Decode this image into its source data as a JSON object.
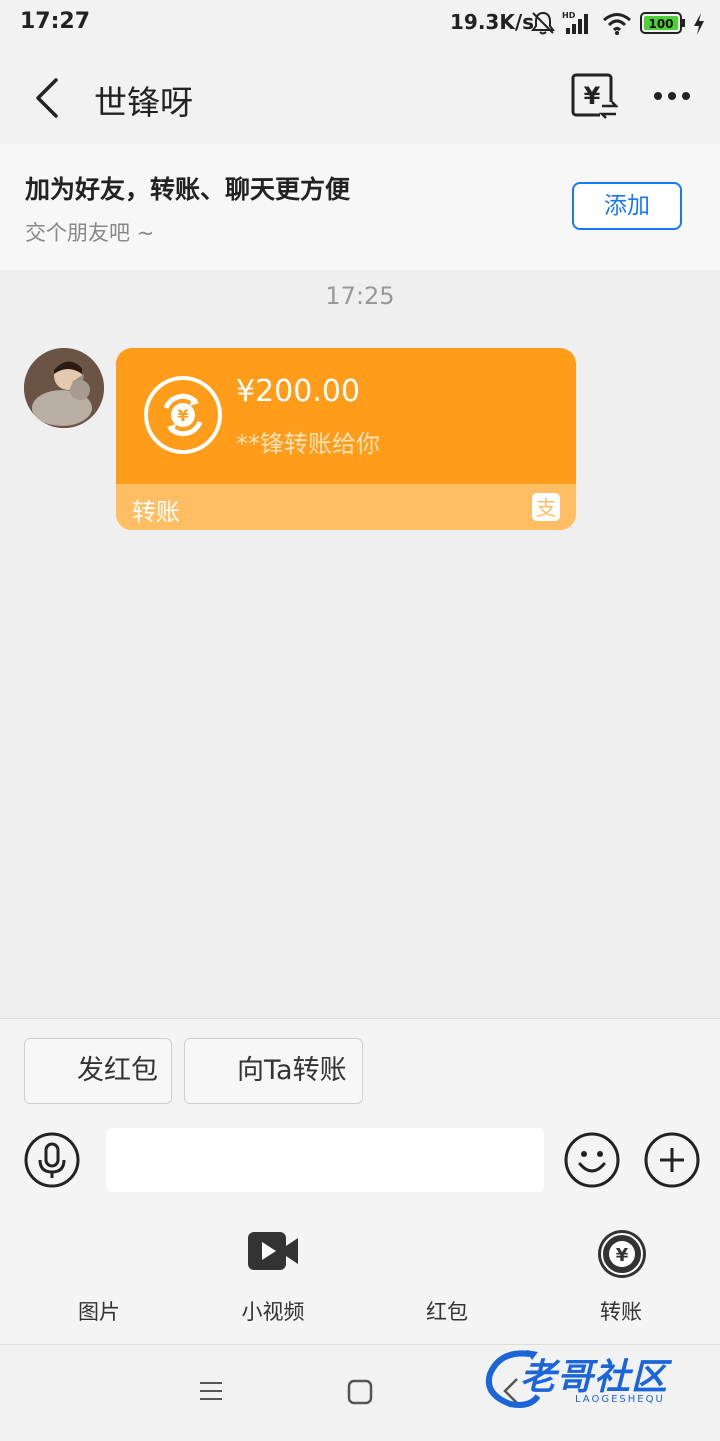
{
  "status_bar": {
    "time": "17:27",
    "net_speed": "19.3K/s",
    "battery": "100",
    "icons": [
      "bell-muted-icon",
      "hd-signal-icon",
      "wifi-icon",
      "battery-icon",
      "charging-icon"
    ]
  },
  "header": {
    "title": "世锋呀",
    "icons": [
      "back-arrow-icon",
      "transfer-record-icon",
      "more-dots-icon"
    ]
  },
  "friend_banner": {
    "title": "加为好友，转账、聊天更方便",
    "subtitle": "交个朋友吧 ~",
    "button": "添加"
  },
  "messages": {
    "time": "17:25",
    "transfer": {
      "amount": "¥200.00",
      "note": "**锋转账给你",
      "label": "转账",
      "icon": "alipay-icon"
    }
  },
  "quick_actions": {
    "red_packet": "发红包",
    "transfer": "向Ta转账"
  },
  "input": {
    "placeholder": ""
  },
  "tools": [
    {
      "label": "图片",
      "icon": "image-icon"
    },
    {
      "label": "小视频",
      "icon": "video-icon"
    },
    {
      "label": "红包",
      "icon": "red-packet-icon"
    },
    {
      "label": "转账",
      "icon": "transfer-icon"
    }
  ],
  "watermark": {
    "text": "老哥社区",
    "sub": "LAOGESHEQU"
  },
  "colors": {
    "accent_blue": "#1677ff",
    "transfer_orange": "#ff9c1a",
    "transfer_footer": "#ffbe63"
  }
}
